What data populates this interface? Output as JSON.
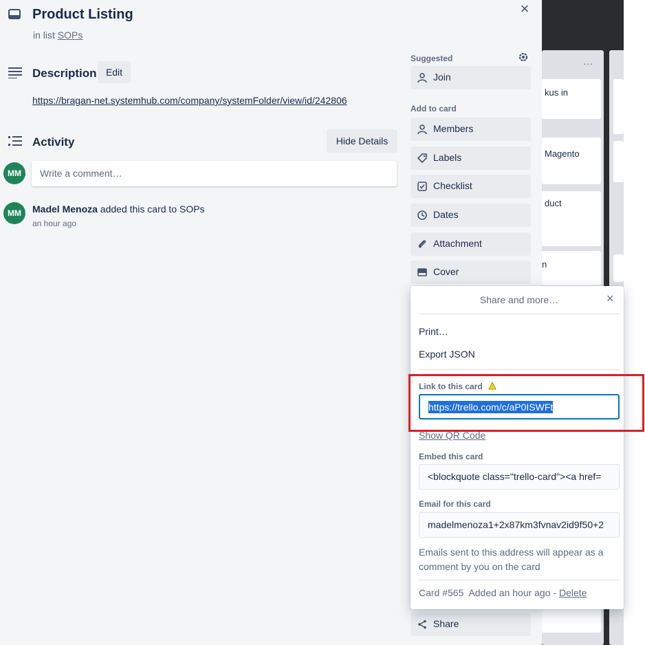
{
  "card": {
    "title": "Product Listing",
    "in_list_prefix": "in list",
    "list_name": "SOPs",
    "close_symbol": "×"
  },
  "description": {
    "heading": "Description",
    "edit_label": "Edit",
    "link": "https://bragan-net.systemhub.com/company/systemFolder/view/id/242806"
  },
  "activity": {
    "heading": "Activity",
    "hide_details_label": "Hide Details",
    "comment_placeholder": "Write a comment…",
    "avatar_initials": "MM",
    "entries": [
      {
        "user": "Madel Menoza",
        "action": "added this card to SOPs",
        "time": "an hour ago"
      }
    ]
  },
  "sidebar": {
    "suggested_heading": "Suggested",
    "join_label": "Join",
    "add_to_card_heading": "Add to card",
    "buttons": [
      {
        "label": "Members",
        "icon": "person-icon"
      },
      {
        "label": "Labels",
        "icon": "tag-icon"
      },
      {
        "label": "Checklist",
        "icon": "checkbox-icon"
      },
      {
        "label": "Dates",
        "icon": "clock-icon"
      },
      {
        "label": "Attachment",
        "icon": "paperclip-icon"
      },
      {
        "label": "Cover",
        "icon": "card-cover-icon"
      }
    ],
    "share_label": "Share"
  },
  "share_popover": {
    "title": "Share and more…",
    "close_symbol": "×",
    "print_label": "Print…",
    "export_label": "Export JSON",
    "link_label": "Link to this card",
    "link_value": "https://trello.com/c/aP0ISWFt",
    "qr_label": "Show QR Code",
    "embed_label": "Embed this card",
    "embed_value": "<blockquote class=\"trello-card\"><a href=",
    "email_label": "Email for this card",
    "email_value": "madelmenoza1+2x87km3fvnav2id9f50+2",
    "email_note": "Emails sent to this address will appear as a comment by you on the card",
    "card_number": "Card #565",
    "added_text": "Added an hour ago -",
    "delete_label": "Delete"
  },
  "board_bg": {
    "snippets": [
      "kus in",
      "Magento",
      "duct",
      "n"
    ],
    "list_menu": "···"
  },
  "colors": {
    "avatar": "#1f845a",
    "highlight_box": "#e01e1e",
    "selection": "#1f6fde",
    "input_focus": "#0079bf"
  }
}
